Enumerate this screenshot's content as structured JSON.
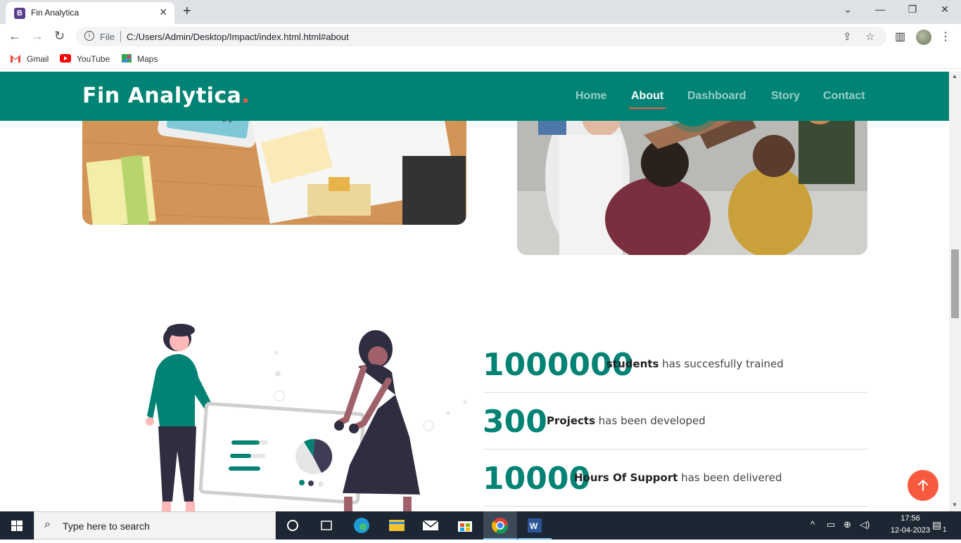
{
  "browser": {
    "tab_title": "Fin Analytica",
    "tab_favicon": "B",
    "new_tab": "+",
    "close_tab": "✕",
    "file_label": "File",
    "url": "C:/Users/Admin/Desktop/Impact/index.html.html#about",
    "bookmarks": [
      "Gmail",
      "YouTube",
      "Maps"
    ]
  },
  "site": {
    "logo": "Fin Analytica",
    "logo_dot": ".",
    "nav": [
      "Home",
      "About",
      "Dashboard",
      "Story",
      "Contact"
    ],
    "active_nav": "About",
    "accent_color": "#008374",
    "highlight_color": "#f85a40"
  },
  "stats": [
    {
      "number": "1000000",
      "strong": "students",
      "rest": " has succesfully trained"
    },
    {
      "number": "300",
      "strong": "Projects",
      "rest": " has been developed"
    },
    {
      "number": "10000",
      "strong": "Hours Of Support",
      "rest": " has been delivered"
    }
  ],
  "taskbar": {
    "search_placeholder": "Type here to search",
    "time": "17:56",
    "date": "12-04-2023",
    "notification_count": "1"
  }
}
